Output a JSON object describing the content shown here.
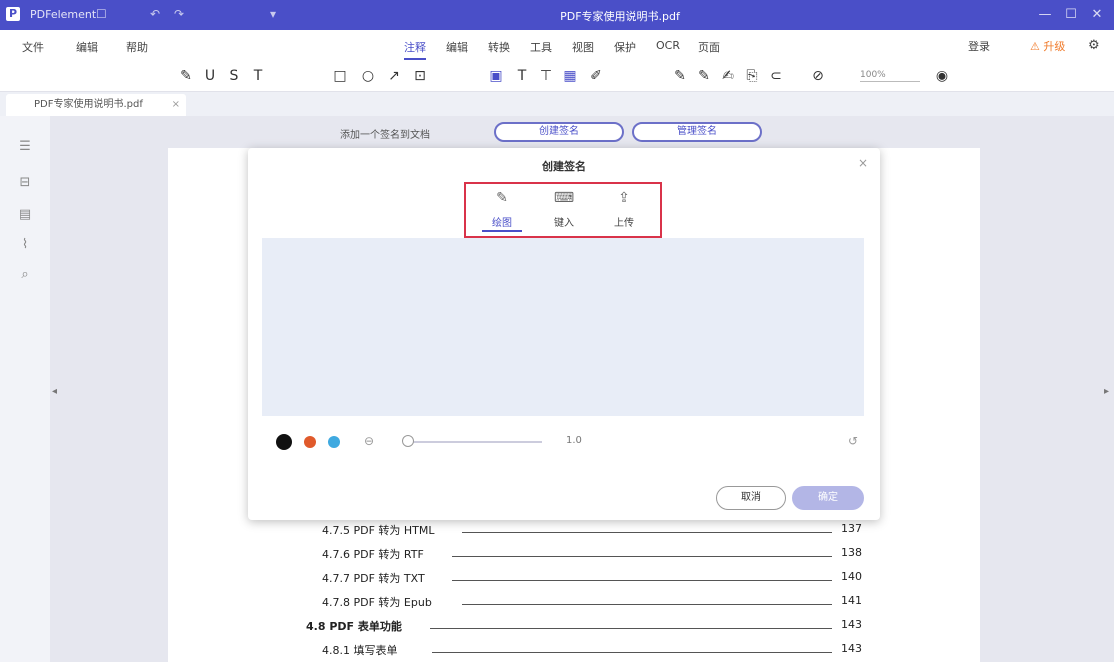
{
  "titlebar": {
    "app_name": "PDFelement",
    "title": "PDF专家使用说明书.pdf",
    "quick_actions": [
      "☐",
      "↶",
      "↷",
      "▾"
    ],
    "window_controls": [
      "—",
      "☐",
      "✕"
    ]
  },
  "menubar": {
    "left": [
      "文件",
      "编辑",
      "帮助"
    ],
    "tabs": [
      "注释",
      "编辑",
      "转换",
      "工具",
      "视图",
      "保护",
      "OCR",
      "页面"
    ],
    "active_tab": "注释",
    "right": [
      "登录",
      "⚠ 升级"
    ]
  },
  "toolbar": {
    "zoom_label": "100%"
  },
  "doc_tab": {
    "name": "PDF专家使用说明书.pdf",
    "close": "×"
  },
  "signbar": {
    "label": "添加一个签名到文档",
    "buttons": [
      "创建签名",
      "管理签名"
    ]
  },
  "dialog": {
    "title": "创建签名",
    "close": "×",
    "modes": [
      {
        "icon": "✎",
        "label": "绘图",
        "active": true
      },
      {
        "icon": "⌨",
        "label": "键入",
        "active": false
      },
      {
        "icon": "⇪",
        "label": "上传",
        "active": false
      }
    ],
    "colors": [
      "#111111",
      "#e05a2b",
      "#3fa9e0"
    ],
    "pen_width": "1.0",
    "cancel_label": "取消",
    "ok_label": "确定"
  },
  "toc": [
    {
      "title": "4.7.5 PDF 转为 HTML",
      "page": "137"
    },
    {
      "title": "4.7.6 PDF 转为 RTF",
      "page": "138"
    },
    {
      "title": "4.7.7 PDF 转为 TXT",
      "page": "140"
    },
    {
      "title": "4.7.8 PDF 转为 Epub",
      "page": "141"
    },
    {
      "title": "4.8 PDF 表单功能",
      "page": "143"
    },
    {
      "title": "4.8.1 填写表单",
      "page": "143"
    }
  ]
}
